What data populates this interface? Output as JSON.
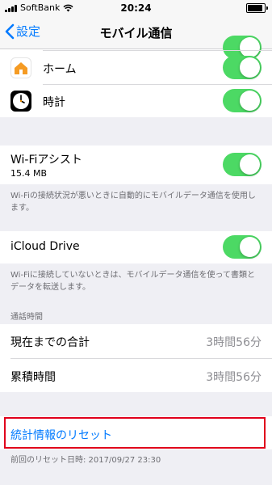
{
  "status_bar": {
    "carrier": "SoftBank",
    "time": "20:24"
  },
  "nav": {
    "back_label": "設定",
    "title": "モバイル通信"
  },
  "apps": [
    {
      "name": "ホーム",
      "icon": "home-icon",
      "enabled": true
    },
    {
      "name": "時計",
      "icon": "clock-icon",
      "enabled": true
    }
  ],
  "wifi_assist": {
    "label": "Wi-Fiアシスト",
    "usage": "15.4 MB",
    "enabled": true,
    "footer": "Wi-Fiの接続状況が悪いときに自動的にモバイルデータ通信を使用します。"
  },
  "icloud_drive": {
    "label": "iCloud Drive",
    "enabled": true,
    "footer": "Wi-Fiに接続していないときは、モバイルデータ通信を使って書類とデータを転送します。"
  },
  "call_time": {
    "header": "通話時間",
    "rows": [
      {
        "label": "現在までの合計",
        "value": "3時間56分"
      },
      {
        "label": "累積時間",
        "value": "3時間56分"
      }
    ]
  },
  "reset": {
    "label": "統計情報のリセット",
    "last_reset": "前回のリセット日時: 2017/09/27 23:30"
  },
  "colors": {
    "accent": "#007aff",
    "toggle_on": "#4cd964",
    "highlight": "#e0001b"
  }
}
